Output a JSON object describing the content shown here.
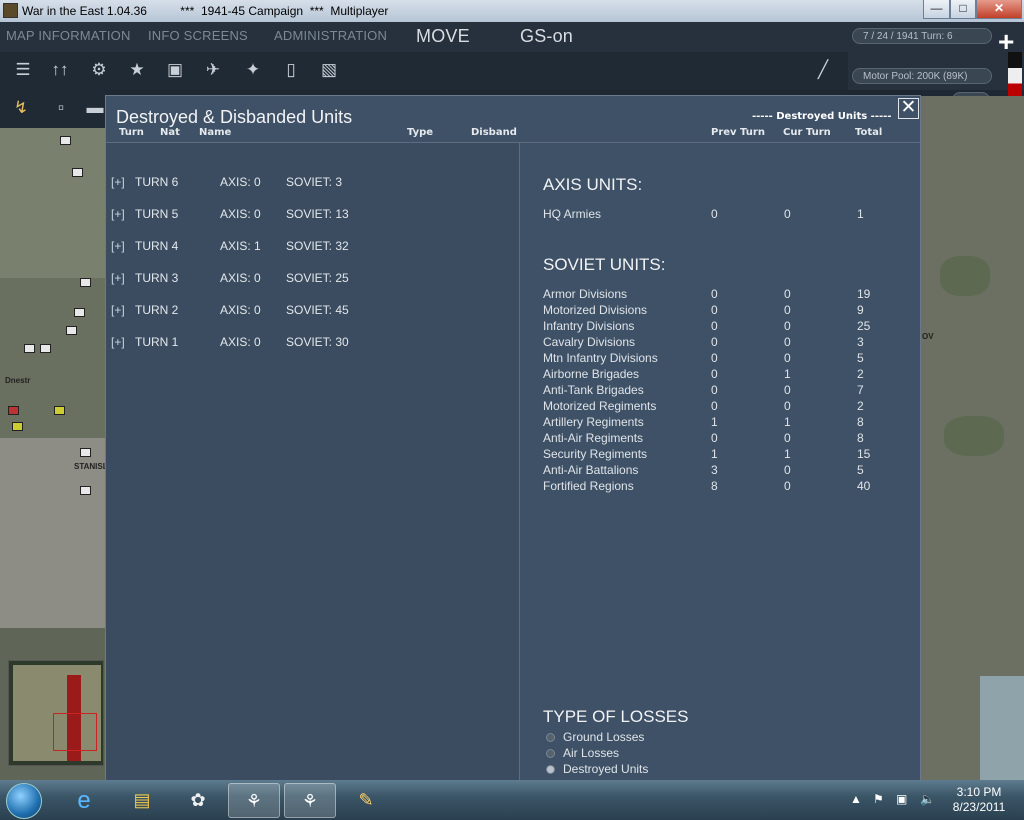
{
  "window": {
    "title": "War in the East 1.04.36          ***  1941-45 Campaign  ***  Multiplayer",
    "min_glyph": "—",
    "max_glyph": "□",
    "close_glyph": "✕"
  },
  "menu": {
    "map_information": "MAP INFORMATION",
    "info_screens": "INFO SCREENS",
    "administration": "ADMINISTRATION",
    "move": "MOVE",
    "gs_on": "GS-on"
  },
  "toolbar_icons": [
    "ground-units-icon",
    "arrows-up-icon",
    "gear-icon",
    "star-icon",
    "airbase-icon",
    "aircraft-icon",
    "bomber-icon",
    "rail-icon",
    "phone-icon",
    "pencil-icon"
  ],
  "status": {
    "date_turn": "7 / 24 / 1941  Turn: 6",
    "motor_pool": "Motor Pool:  200K (89K)",
    "field3": "0",
    "plus_glyph": "+"
  },
  "map": {
    "labels": [
      "Dnestr",
      "STANISL",
      "OV"
    ]
  },
  "modal": {
    "title": "Destroyed & Disbanded Units",
    "destroyed_units_header": "----- Destroyed Units -----",
    "close_glyph": "✕",
    "columns": {
      "turn": "Turn",
      "nat": "Nat",
      "name": "Name",
      "type": "Type",
      "disband": "Disband",
      "prev_turn": "Prev Turn",
      "cur_turn": "Cur Turn",
      "total": "Total"
    },
    "turns": [
      {
        "expander": "[+]",
        "turn": "TURN 6",
        "axis": "AXIS: 0",
        "soviet": "SOVIET: 3"
      },
      {
        "expander": "[+]",
        "turn": "TURN 5",
        "axis": "AXIS: 0",
        "soviet": "SOVIET: 13"
      },
      {
        "expander": "[+]",
        "turn": "TURN 4",
        "axis": "AXIS: 1",
        "soviet": "SOVIET: 32"
      },
      {
        "expander": "[+]",
        "turn": "TURN 3",
        "axis": "AXIS: 0",
        "soviet": "SOVIET: 25"
      },
      {
        "expander": "[+]",
        "turn": "TURN 2",
        "axis": "AXIS: 0",
        "soviet": "SOVIET: 45"
      },
      {
        "expander": "[+]",
        "turn": "TURN 1",
        "axis": "AXIS: 0",
        "soviet": "SOVIET: 30"
      }
    ],
    "axis_header": "AXIS UNITS:",
    "axis_rows": [
      {
        "name": "HQ Armies",
        "prev": "0",
        "cur": "0",
        "total": "1"
      }
    ],
    "soviet_header": "SOVIET UNITS:",
    "soviet_rows": [
      {
        "name": "Armor Divisions",
        "prev": "0",
        "cur": "0",
        "total": "19"
      },
      {
        "name": "Motorized Divisions",
        "prev": "0",
        "cur": "0",
        "total": "9"
      },
      {
        "name": "Infantry Divisions",
        "prev": "0",
        "cur": "0",
        "total": "25"
      },
      {
        "name": "Cavalry Divisions",
        "prev": "0",
        "cur": "0",
        "total": "3"
      },
      {
        "name": "Mtn Infantry Divisions",
        "prev": "0",
        "cur": "0",
        "total": "5"
      },
      {
        "name": "Airborne Brigades",
        "prev": "0",
        "cur": "1",
        "total": "2"
      },
      {
        "name": "Anti-Tank Brigades",
        "prev": "0",
        "cur": "0",
        "total": "7"
      },
      {
        "name": "Motorized Regiments",
        "prev": "0",
        "cur": "0",
        "total": "2"
      },
      {
        "name": "Artillery Regiments",
        "prev": "1",
        "cur": "1",
        "total": "8"
      },
      {
        "name": "Anti-Air Regiments",
        "prev": "0",
        "cur": "0",
        "total": "8"
      },
      {
        "name": "Security Regiments",
        "prev": "1",
        "cur": "1",
        "total": "15"
      },
      {
        "name": "Anti-Air Battalions",
        "prev": "3",
        "cur": "0",
        "total": "5"
      },
      {
        "name": "Fortified Regions",
        "prev": "8",
        "cur": "0",
        "total": "40"
      }
    ],
    "losses_header": "TYPE OF LOSSES",
    "loss_types": [
      {
        "label": "Ground Losses",
        "selected": false
      },
      {
        "label": "Air Losses",
        "selected": false
      },
      {
        "label": "Destroyed Units",
        "selected": true
      }
    ]
  },
  "taskbar": {
    "time": "3:10 PM",
    "date": "8/23/2011",
    "apps": [
      "windows-start-icon",
      "internet-explorer-icon",
      "file-explorer-icon",
      "flower-app-icon",
      "war-in-the-east-icon",
      "war-in-the-east-icon",
      "paint-icon"
    ]
  }
}
